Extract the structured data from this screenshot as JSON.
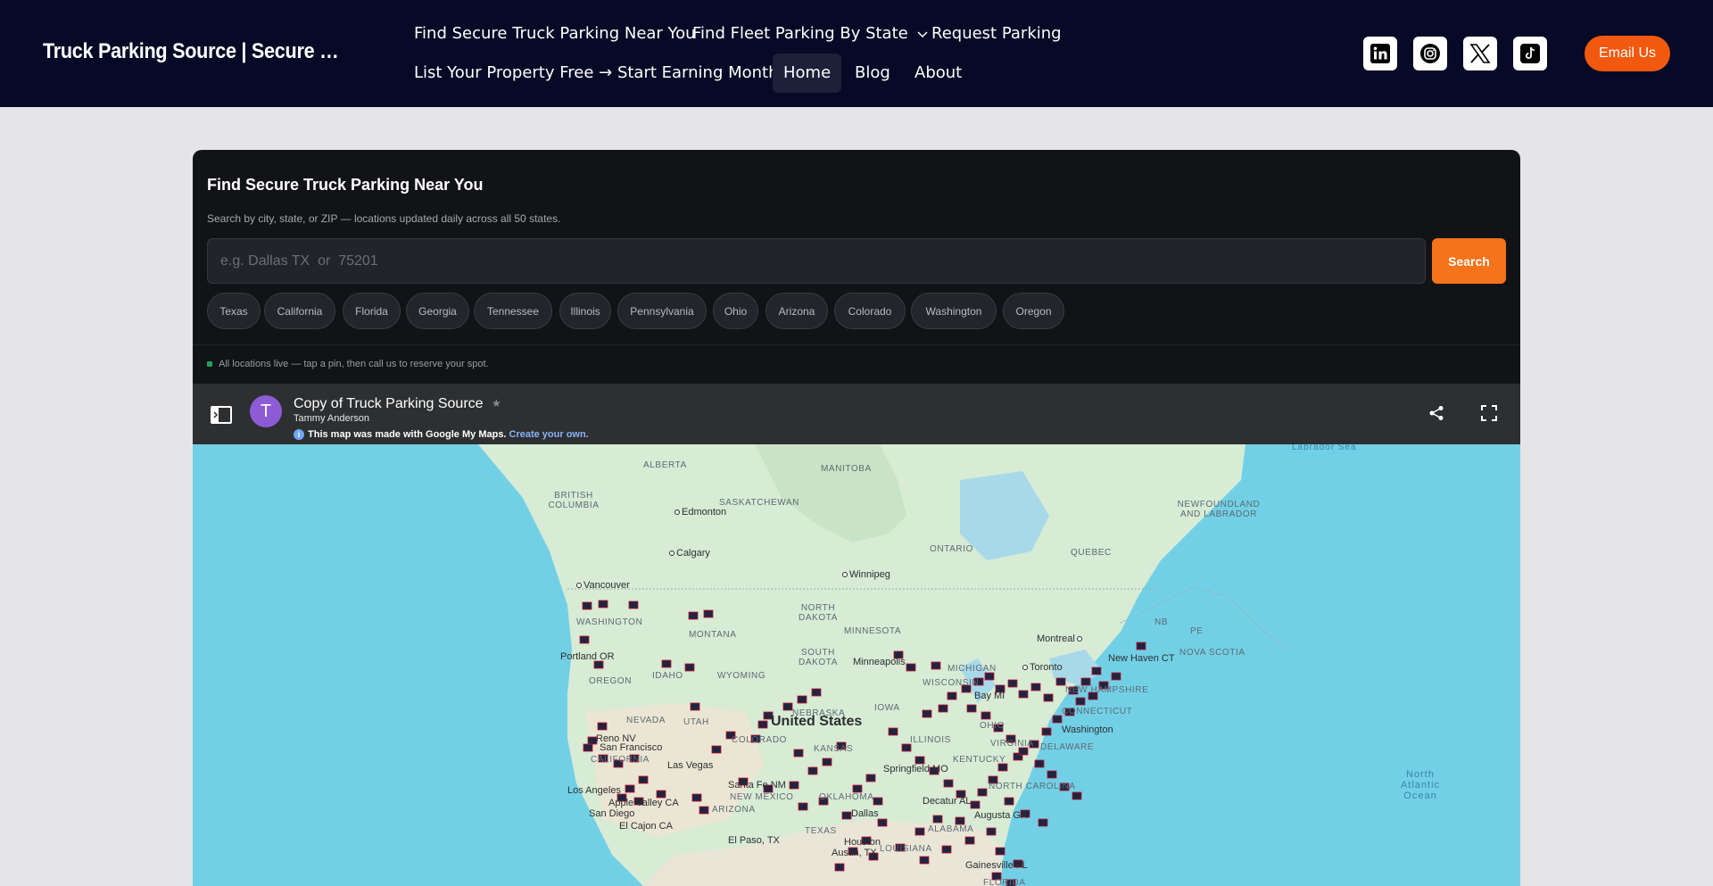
{
  "header": {
    "site_title": "Truck Parking Source | Secure Truc...",
    "nav": [
      {
        "label": "Find Secure Truck Parking Near You"
      },
      {
        "label": "Find Fleet Parking By State"
      },
      {
        "label": "Request Parking"
      },
      {
        "label": "List Your Property Free → Start Earning Monthly"
      },
      {
        "label": "Home"
      },
      {
        "label": "Blog"
      },
      {
        "label": "About"
      }
    ],
    "social_icons": [
      "linkedin-icon",
      "instagram-icon",
      "x-icon",
      "tiktok-icon"
    ],
    "email_button": "Email Us"
  },
  "finder": {
    "title": "Find Secure Truck Parking Near You",
    "subtitle": "Search by city, state, or ZIP — locations updated daily across all 50 states.",
    "search_placeholder": "e.g. Dallas TX  or  75201",
    "search_button": "Search",
    "state_chips": [
      "Texas",
      "California",
      "Florida",
      "Georgia",
      "Tennessee",
      "Illinois",
      "Pennsylvania",
      "Ohio",
      "Arizona",
      "Colorado",
      "Washington",
      "Oregon"
    ],
    "status_text": "All locations live — tap a pin, then call us to reserve your spot."
  },
  "map": {
    "avatar_letter": "T",
    "name": "Copy of Truck Parking Source",
    "author": "Tammy Anderson",
    "made_with": "This map was made with Google My Maps.",
    "create_link": "Create your own.",
    "region_labels": [
      "ALBERTA",
      "MANITOBA",
      "BRITISH COLUMBIA",
      "SASKATCHEWAN",
      "NEWFOUNDLAND AND LABRADOR",
      "ONTARIO",
      "QUEBEC",
      "NORTH DAKOTA",
      "MINNESOTA",
      "SOUTH DAKOTA",
      "WISCONSIN",
      "MONTANA",
      "WYOMING",
      "IDAHO",
      "OREGON",
      "WASHINGTON",
      "NEVADA",
      "UTAH",
      "COLORADO",
      "KANSAS",
      "NEBRASKA",
      "IOWA",
      "ILLINOIS",
      "MICHIGAN",
      "OHIO",
      "KENTUCKY",
      "VIRGINIA",
      "NORTH CAROLINA",
      "OKLAHOMA",
      "ARIZONA",
      "NEW MEXICO",
      "TEXAS",
      "LOUISIANA",
      "ALABAMA",
      "CALIFORNIA",
      "NEW HAMPSHIRE",
      "CONNECTICUT",
      "DELAWARE",
      "NOVA SCOTIA",
      "NB",
      "PE",
      "FLORIDA"
    ],
    "cities": [
      "Edmonton",
      "Calgary",
      "Vancouver",
      "Winnipeg",
      "Montreal",
      "Toronto",
      "New Haven CT",
      "Portland OR",
      "Reno NV",
      "San Francisco",
      "Las Vegas",
      "Los Angeles",
      "Apple Valley CA",
      "San Diego",
      "El Cajon CA",
      "El Paso, TX",
      "Santa Fe NM",
      "Dallas",
      "Austin, TX",
      "Houston",
      "Springfield MO",
      "Decatur AL",
      "Augusta GA",
      "Gainesville FL",
      "Minneapolis",
      "Bay MI",
      "Washington",
      "United States"
    ],
    "oceans": [
      "Labrador Sea",
      "North Atlantic Ocean"
    ]
  }
}
